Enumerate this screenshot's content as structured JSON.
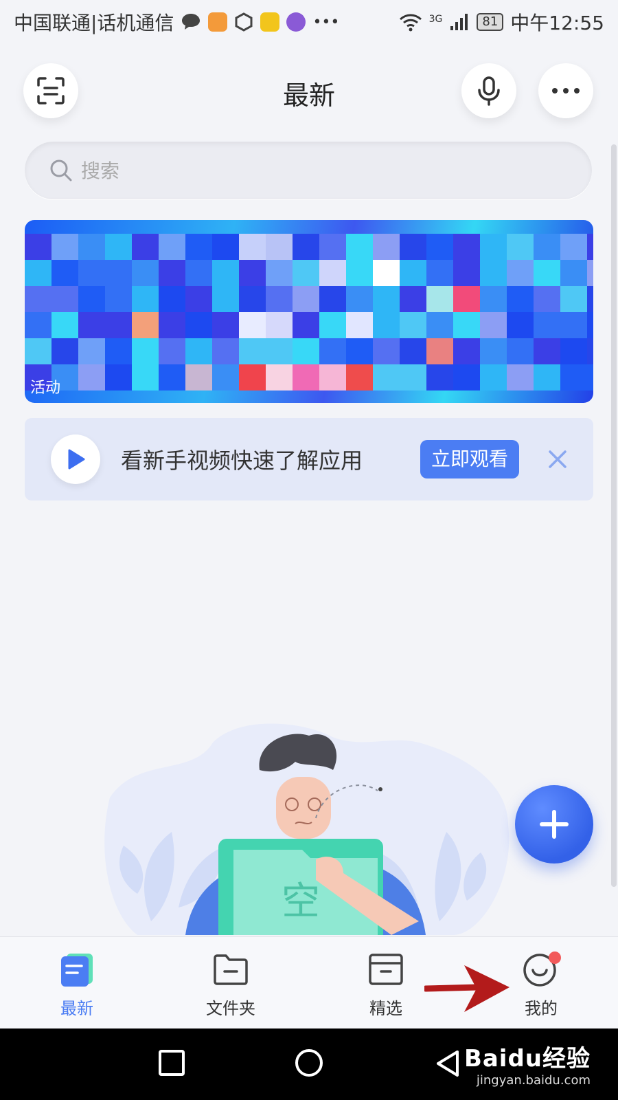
{
  "status_bar": {
    "carrier": "中国联通|话机通信",
    "network": "3G",
    "battery": "81",
    "time": "中午12:55"
  },
  "header": {
    "title": "最新",
    "scan_icon": "scan-icon",
    "mic_icon": "microphone-icon",
    "more_icon": "more-icon"
  },
  "search": {
    "placeholder": "搜索",
    "icon": "search-icon"
  },
  "banner": {
    "tag": "活动"
  },
  "tutorial": {
    "text": "看新手视频快速了解应用",
    "button_label": "立即观看"
  },
  "empty_state": {
    "illustration_label": "空"
  },
  "tabbar": {
    "items": [
      {
        "label": "最新",
        "icon": "recent-doc-icon",
        "active": true
      },
      {
        "label": "文件夹",
        "icon": "folder-icon",
        "active": false
      },
      {
        "label": "精选",
        "icon": "featured-box-icon",
        "active": false
      },
      {
        "label": "我的",
        "icon": "profile-smile-icon",
        "active": false
      }
    ]
  },
  "watermark": {
    "brand": "Baidu经验",
    "url": "jingyan.baidu.com"
  },
  "colors": {
    "accent": "#4b7df3",
    "notification_dot": "#f25a5a",
    "annotation_arrow": "#b31b1b"
  }
}
